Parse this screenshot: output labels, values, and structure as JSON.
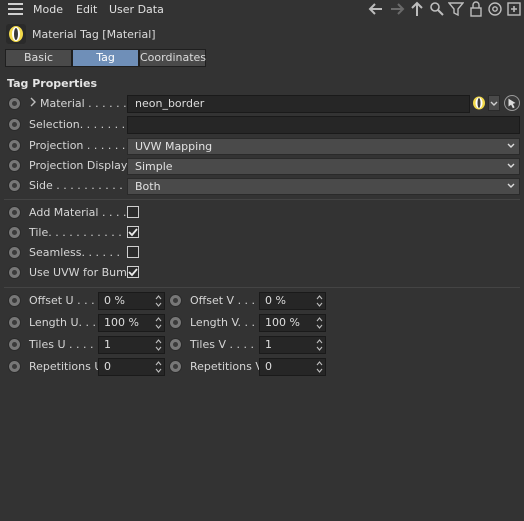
{
  "menubar": {
    "items": [
      "Mode",
      "Edit",
      "User Data"
    ]
  },
  "header": {
    "title": "Material Tag [Material]"
  },
  "tabs": [
    {
      "label": "Basic",
      "active": false
    },
    {
      "label": "Tag",
      "active": true
    },
    {
      "label": "Coordinates",
      "active": false
    }
  ],
  "section": {
    "title": "Tag Properties"
  },
  "properties": {
    "material": {
      "label": "Material . . . . . .",
      "value": "neon_border"
    },
    "selection": {
      "label": "Selection. . . . . . .",
      "value": ""
    },
    "projection": {
      "label": "Projection . . . . . .",
      "value": "UVW Mapping"
    },
    "projection_display": {
      "label": "Projection Display",
      "value": "Simple"
    },
    "side": {
      "label": "Side . . . . . . . . . .",
      "value": "Both"
    }
  },
  "checks": {
    "add_material": {
      "label": "Add Material . . . .",
      "checked": false
    },
    "tile": {
      "label": "Tile. . . . . . . . . . .",
      "checked": true
    },
    "seamless": {
      "label": "Seamless. . . . . .",
      "checked": false
    },
    "use_uvw_bump": {
      "label": "Use UVW for Bump",
      "checked": true
    }
  },
  "numeric": {
    "offset_u": {
      "label": "Offset U . . .",
      "value": "0 %"
    },
    "offset_v": {
      "label": "Offset V . . .",
      "value": "0 %"
    },
    "length_u": {
      "label": "Length U. . .",
      "value": "100 %"
    },
    "length_v": {
      "label": "Length V. . .",
      "value": "100 %"
    },
    "tiles_u": {
      "label": "Tiles U . . . .",
      "value": "1"
    },
    "tiles_v": {
      "label": "Tiles V . . . .",
      "value": "1"
    },
    "repetitions_u": {
      "label": "Repetitions U",
      "value": "0"
    },
    "repetitions_v": {
      "label": "Repetitions V",
      "value": "0"
    }
  },
  "colors": {
    "background": "#333333",
    "active_tab": "#6f8fb8",
    "field": "#262626",
    "dropdown": "#4a4a4a",
    "material_accent": "#f2d94a"
  }
}
